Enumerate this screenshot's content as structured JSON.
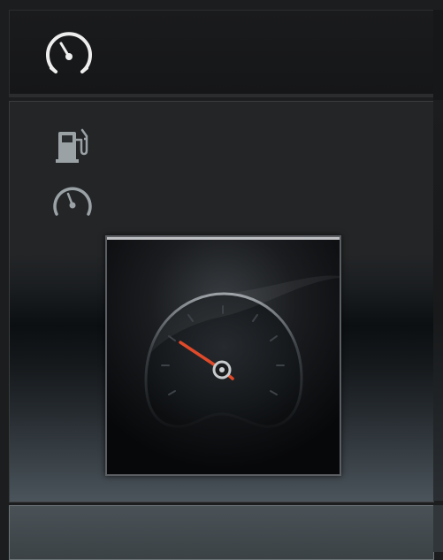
{
  "colors": {
    "icon_stroke": "#e9eaeb",
    "icon_muted": "#8e9497",
    "needle": "#e04a2a",
    "tile_border": "#5b5e62"
  },
  "icons": {
    "top": "speedometer-icon",
    "fuel": "fuel-pump-icon",
    "speed": "speedometer-icon"
  },
  "preview": {
    "icon": "speedometer-gauge-icon"
  }
}
